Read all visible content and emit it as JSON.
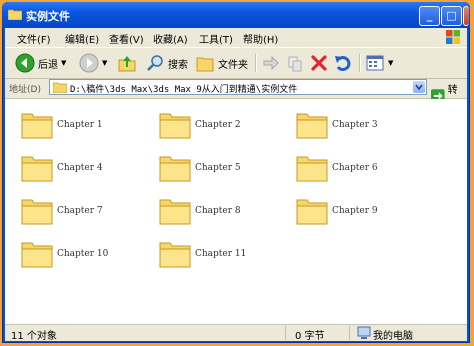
{
  "window": {
    "title": "实例文件"
  },
  "menu": [
    "文件(F)",
    "编辑(E)",
    "查看(V)",
    "收藏(A)",
    "工具(T)",
    "帮助(H)"
  ],
  "toolbar": {
    "back_label": "后退",
    "search_label": "搜索",
    "folders_label": "文件夹"
  },
  "address": {
    "label": "地址(D)",
    "path": "D:\\稿件\\3ds Max\\3ds Max 9从入门到精通\\实例文件",
    "go_label": "转到"
  },
  "folders": [
    "Chapter 1",
    "Chapter 2",
    "Chapter 3",
    "Chapter 4",
    "Chapter 5",
    "Chapter 6",
    "Chapter 7",
    "Chapter 8",
    "Chapter 9",
    "Chapter 10",
    "Chapter 11"
  ],
  "status": {
    "objects": "11 个对象",
    "size": "0 字节",
    "location": "我的电脑"
  },
  "colors": {
    "titlebar": "#0b55e0",
    "folder": "#f5d66a",
    "desktop": "#f2a33a"
  }
}
